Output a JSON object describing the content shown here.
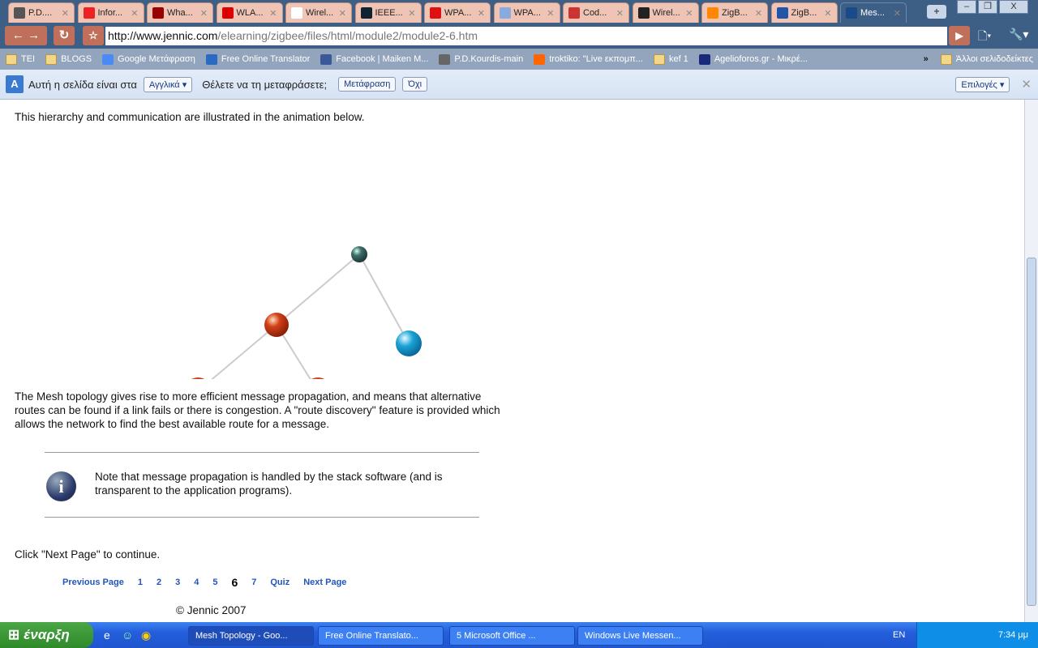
{
  "browser": {
    "tabs": [
      {
        "label": "P.D....",
        "color": "#555"
      },
      {
        "label": "Infor...",
        "color": "#e22"
      },
      {
        "label": "Wha...",
        "color": "#900"
      },
      {
        "label": "WLA...",
        "color": "#d00"
      },
      {
        "label": "Wirel...",
        "color": "#fff"
      },
      {
        "label": "IEEE...",
        "color": "#123"
      },
      {
        "label": "WPA...",
        "color": "#d11"
      },
      {
        "label": "WPA...",
        "color": "#8ad"
      },
      {
        "label": "Cod...",
        "color": "#c33"
      },
      {
        "label": "Wirel...",
        "color": "#222"
      },
      {
        "label": "ZigB...",
        "color": "#f80"
      },
      {
        "label": "ZigB...",
        "color": "#25a"
      },
      {
        "label": "Mes...",
        "color": "#1a4a8a"
      }
    ],
    "url_host": "http://www.jennic.com",
    "url_path": "/elearning/zigbee/files/html/module2/module2-6.htm",
    "bookmarks": [
      {
        "label": "TEI",
        "icon": "folder"
      },
      {
        "label": "BLOGS",
        "icon": "folder"
      },
      {
        "label": "Google Μετάφραση",
        "icon": "google"
      },
      {
        "label": "Free Online Translator",
        "icon": "translator"
      },
      {
        "label": "Facebook | Maiken M...",
        "icon": "facebook"
      },
      {
        "label": "P.D.Kourdis-main",
        "icon": "site"
      },
      {
        "label": "troktiko: \"Live εκπομπ...",
        "icon": "blogger"
      },
      {
        "label": "kef 1",
        "icon": "folder"
      },
      {
        "label": "Agelioforos.gr - Μικρέ...",
        "icon": "a-logo"
      }
    ],
    "other_bookmarks": "Άλλοι σελιδοδείκτες",
    "translate": {
      "text1": "Αυτή η σελίδα είναι στα",
      "language": "Αγγλικά",
      "text2": "Θέλετε να τη μεταφράσετε;",
      "translate_btn": "Μετάφραση",
      "no_btn": "Όχι",
      "options_btn": "Επιλογές"
    }
  },
  "page": {
    "intro": "This hierarchy and communication are illustrated in the animation below.",
    "para": "The Mesh topology gives rise to more efficient message propagation, and means that alternative routes can be found if a link fails or there is congestion. A \"route discovery\" feature is provided which allows the network to find the best available route for a message.",
    "note": "Note that message propagation is handled by the stack software (and is transparent to the application programs).",
    "continue": "Click \"Next Page\" to continue.",
    "pager": {
      "prev": "Previous Page",
      "pages": [
        "1",
        "2",
        "3",
        "4",
        "5",
        "6",
        "7"
      ],
      "current": "6",
      "quiz": "Quiz",
      "next": "Next Page"
    },
    "copyright": "© Jennic 2007",
    "colors": {
      "coordinator": "#3f6e6a",
      "router": "#d3401a",
      "end_device": "#1aa3d6",
      "active": "#e79b80"
    }
  },
  "taskbar": {
    "start": "έναρξη",
    "tasks": [
      "Mesh Topology - Goo...",
      "Free Online Translato...",
      "5 Microsoft Office ...",
      "Windows Live Messen..."
    ],
    "lang": "EN",
    "time": "7:34 μμ"
  }
}
